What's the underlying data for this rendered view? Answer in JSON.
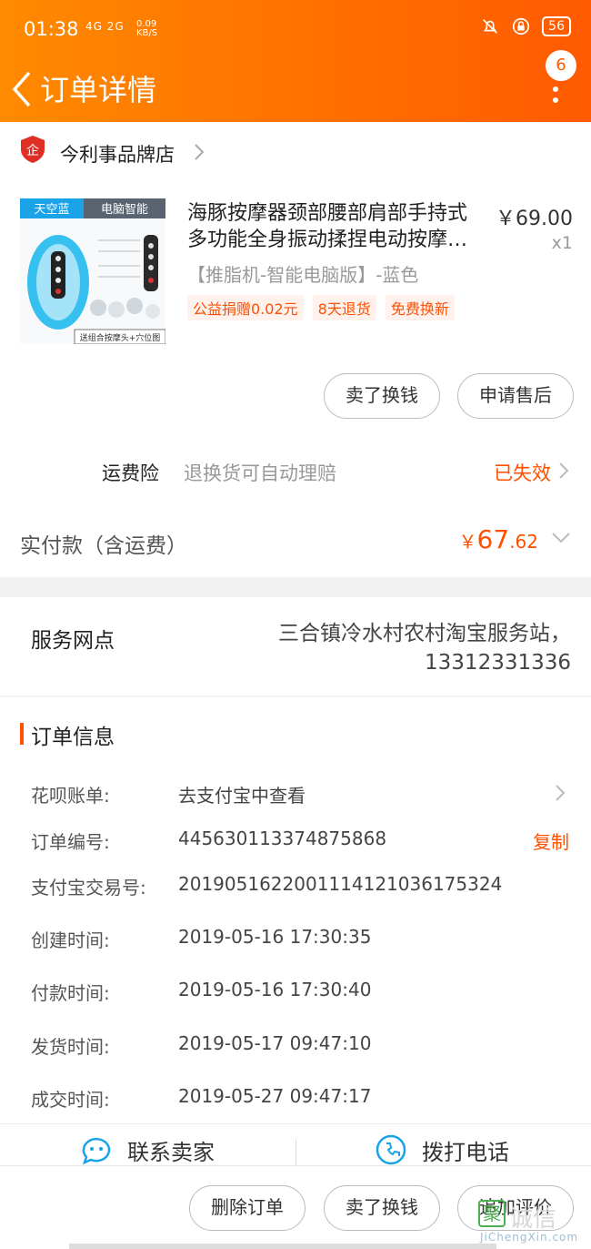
{
  "status_bar": {
    "time": "01:38",
    "network": "4G 2G",
    "speed_value": "0.09",
    "speed_unit": "KB/S",
    "battery": "56"
  },
  "nav": {
    "title": "订单详情",
    "badge_count": "6"
  },
  "shop": {
    "name": "今利事品牌店"
  },
  "product": {
    "image_label_left": "天空蓝",
    "image_label_right": "电脑智能",
    "image_caption": "送组合按摩头+穴位图",
    "title": "海豚按摩器颈部腰部肩部手持式多功能全身振动揉捏电动按摩…",
    "price": "￥69.00",
    "quantity": "x1",
    "sku": "【推脂机-智能电脑版】-蓝色",
    "tags": [
      "公益捐赠0.02元",
      "8天退货",
      "免费换新"
    ]
  },
  "item_actions": {
    "sell": "卖了换钱",
    "after_sale": "申请售后"
  },
  "insurance": {
    "label": "运费险",
    "desc": "退换货可自动理赔",
    "status": "已失效"
  },
  "payment": {
    "label": "实付款（含运费）",
    "currency": "￥",
    "amount_int": "67",
    "amount_dec": ".62"
  },
  "service": {
    "label": "服务网点",
    "value": "三合镇冷水村农村淘宝服务站，13312331336"
  },
  "order_info": {
    "title": "订单信息",
    "rows": [
      {
        "key": "花呗账单:",
        "value": "去支付宝中查看"
      },
      {
        "key": "订单编号:",
        "value": "445630113374875868",
        "action": "复制"
      },
      {
        "key": "支付宝交易号:",
        "value": "2019051622001114121036175324"
      },
      {
        "key": "创建时间:",
        "value": "2019-05-16 17:30:35"
      },
      {
        "key": "付款时间:",
        "value": "2019-05-16 17:30:40"
      },
      {
        "key": "发货时间:",
        "value": "2019-05-17 09:47:10"
      },
      {
        "key": "成交时间:",
        "value": "2019-05-27 09:47:17"
      }
    ]
  },
  "contact": {
    "seller": "联系卖家",
    "phone": "拨打电话"
  },
  "bottom_actions": {
    "delete": "删除订单",
    "sell": "卖了换钱",
    "review": "追加评价"
  },
  "watermark": {
    "icon": "聚",
    "text": "诚信",
    "url": "JiChengXin.com"
  },
  "colors": {
    "accent": "#ff5000",
    "header_start": "#ff8a00",
    "header_end": "#ff5a00"
  }
}
